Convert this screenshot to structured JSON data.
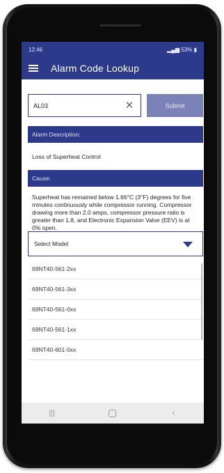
{
  "status_bar": {
    "time": "12:46",
    "battery": "53%"
  },
  "app_bar": {
    "title": "Alarm Code Lookup",
    "menu_icon": "hamburger-menu-icon"
  },
  "search": {
    "value": "AL03",
    "submit_label": "Submit"
  },
  "alarm_description": {
    "header": "Alarm Description:",
    "text": "Loss of Superheat Control"
  },
  "cause": {
    "header": "Cause:",
    "text": "Superheat has remained below 1.66°C (3°F) degrees for five minutes continuously while compressor running. Compressor drawing more than 2.0 amps, compressor pressure ratio is greater than 1.8, and Electronic Expansion Valve (EEV) is at 0% open."
  },
  "model_select": {
    "label": "Select Model",
    "options": [
      "69NT40-561-2xx",
      "69NT40-561-3xx",
      "69NT40-561-0xx",
      "69NT40-561-1xx",
      "69NT40-601-0xx"
    ]
  },
  "nav": {
    "recent": "|||",
    "back": "‹"
  },
  "colors": {
    "primary": "#2d3a8c",
    "button": "#7b82b8"
  }
}
